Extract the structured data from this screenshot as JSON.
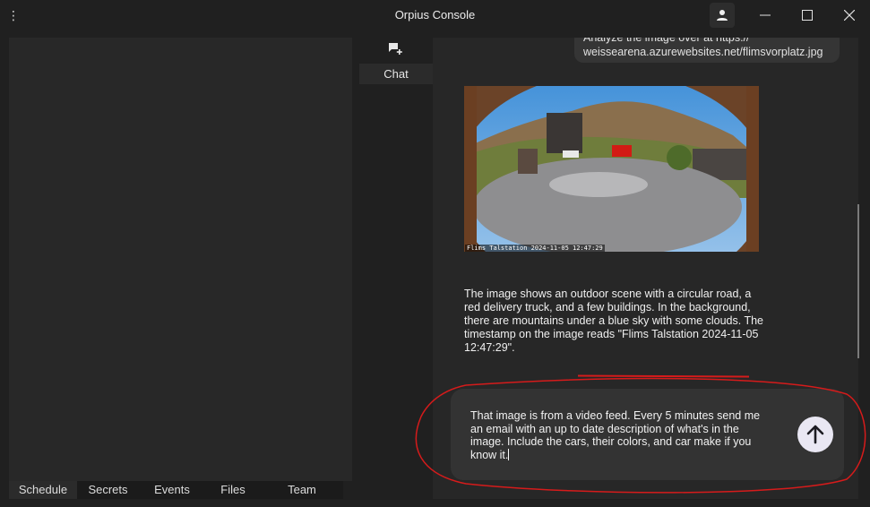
{
  "window": {
    "title": "Orpius Console",
    "menu_icon": "kebab-menu-icon",
    "user_icon": "person-icon",
    "minimize_icon": "minimize-icon",
    "maximize_icon": "maximize-icon",
    "close_icon": "close-icon"
  },
  "bottom_tabs": [
    "Schedule",
    "Secrets",
    "Events",
    "Files",
    "Team"
  ],
  "active_bottom_tab": "Schedule",
  "side_nav": {
    "chat_icon": "chat-add-icon",
    "chat_label": "Chat"
  },
  "chat": {
    "user_message_lines": [
      "Analyze the image over at https://",
      "weissearena.azurewebsites.net/flimsvorplatz.jpg"
    ],
    "image_timestamp": "Flims Talstation 2024-11-05 12:47:29",
    "assistant_message": "The image shows an outdoor scene with a circular road, a red delivery truck, and a few buildings. In the background, there are mountains under a blue sky with some clouds. The timestamp on the image reads \"Flims Talstation 2024-11-05 12:47:29\"."
  },
  "input": {
    "value": "That image is from a video feed. Every 5 minutes send me an email with an up to date description of what's in the image. Include the cars, their colors, and car make if you know it.",
    "send_icon": "arrow-up-icon"
  },
  "colors": {
    "background": "#202020",
    "panel": "#282828",
    "chat_area": "#272727",
    "bubble": "#353535",
    "input_box": "#333333",
    "send_button": "#e9e7f3",
    "annotation": "#d61b1b"
  }
}
